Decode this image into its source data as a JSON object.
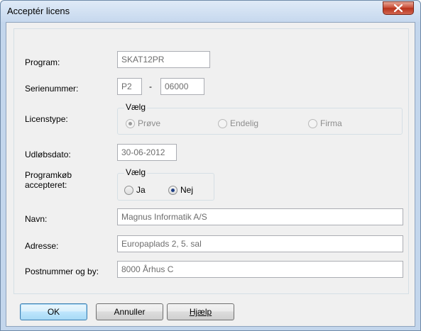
{
  "window": {
    "title": "Acceptér licens"
  },
  "fields": {
    "program": {
      "label": "Program:",
      "value": "SKAT12PR"
    },
    "serienummer": {
      "label": "Serienummer:",
      "part1": "P2",
      "separator": "-",
      "part2": "06000"
    },
    "licenstype": {
      "label": "Licenstype:",
      "group_title": "Vælg",
      "options": [
        "Prøve",
        "Endelig",
        "Firma"
      ],
      "selected": "Prøve"
    },
    "udloebsdato": {
      "label": "Udløbsdato:",
      "value": "30-06-2012"
    },
    "programkoeb": {
      "label_line1": "Programkøb",
      "label_line2": "accepteret:",
      "group_title": "Vælg",
      "options": [
        "Ja",
        "Nej"
      ],
      "selected": "Nej"
    },
    "navn": {
      "label": "Navn:",
      "value": "Magnus Informatik A/S"
    },
    "adresse": {
      "label": "Adresse:",
      "value": "Europaplads 2, 5. sal"
    },
    "postnummer": {
      "label": "Postnummer og by:",
      "value": "8000 Århus C"
    }
  },
  "buttons": {
    "ok": "OK",
    "annuller": "Annuller",
    "hjaelp": "Hjælp"
  }
}
